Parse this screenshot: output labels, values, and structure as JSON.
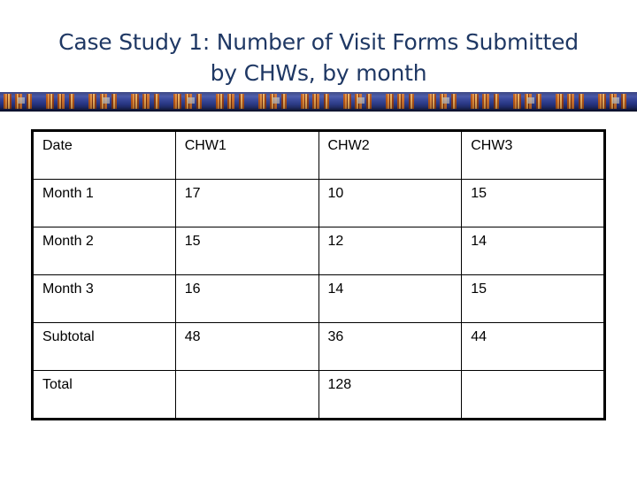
{
  "title": {
    "line1": "Case Study 1: Number of Visit Forms Submitted",
    "line2": "by CHWs, by month",
    "color": "#1f3864"
  },
  "decor_band": {
    "name": "ribbon-divider",
    "background_color": "#2e3f9c",
    "accent_color": "#e8913a"
  },
  "table": {
    "columns": [
      "Date",
      "CHW1",
      "CHW2",
      "CHW3"
    ],
    "rows": [
      [
        "Month 1",
        "17",
        "10",
        "15"
      ],
      [
        "Month 2",
        "15",
        "12",
        "14"
      ],
      [
        "Month 3",
        "16",
        "14",
        "15"
      ],
      [
        "Subtotal",
        "48",
        "36",
        "44"
      ],
      [
        "Total",
        "",
        "128",
        ""
      ]
    ]
  }
}
